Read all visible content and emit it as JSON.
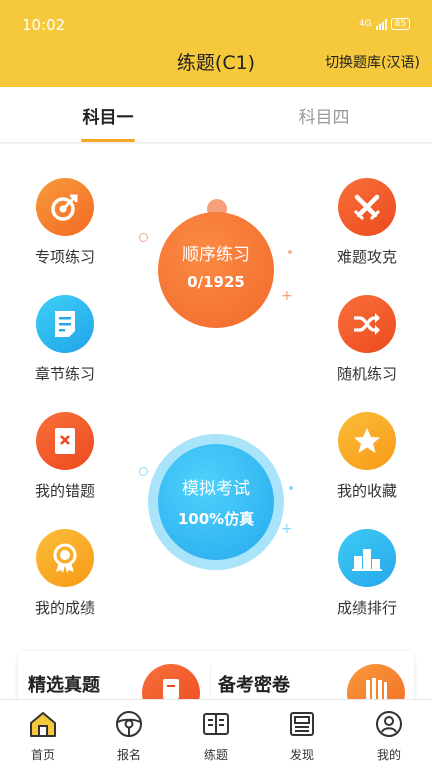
{
  "status_bar": {
    "time": "10:02",
    "network": "4G",
    "battery": "85"
  },
  "header": {
    "title": "练题(C1)",
    "switch_bank": "切换题库(汉语)"
  },
  "tabs": [
    {
      "label": "科目一"
    },
    {
      "label": "科目四"
    }
  ],
  "features": [
    {
      "label": "专项练习",
      "icon": "target-icon"
    },
    {
      "label": "难题攻克",
      "icon": "crossed-swords-icon"
    },
    {
      "label": "章节练习",
      "icon": "document-icon"
    },
    {
      "label": "随机练习",
      "icon": "shuffle-icon"
    },
    {
      "label": "我的错题",
      "icon": "wrong-book-icon"
    },
    {
      "label": "我的收藏",
      "icon": "star-icon"
    },
    {
      "label": "我的成绩",
      "icon": "medal-icon"
    },
    {
      "label": "成绩排行",
      "icon": "podium-icon"
    }
  ],
  "sequential": {
    "title": "顺序练习",
    "progress": "0/1925"
  },
  "mock_exam": {
    "title": "模拟考试",
    "subtitle": "100%仿真"
  },
  "cards": [
    {
      "title": "精选真题"
    },
    {
      "title": "备考密卷"
    }
  ],
  "bottom_nav": [
    {
      "label": "首页",
      "icon": "home-icon"
    },
    {
      "label": "报名",
      "icon": "steering-wheel-icon"
    },
    {
      "label": "练题",
      "icon": "practice-book-icon"
    },
    {
      "label": "发现",
      "icon": "newspaper-icon"
    },
    {
      "label": "我的",
      "icon": "profile-icon"
    }
  ],
  "colors": {
    "accent": "#f6c93c",
    "orange": "#f26a24",
    "blue": "#26a8ee",
    "tab_underline": "#f5a623"
  }
}
